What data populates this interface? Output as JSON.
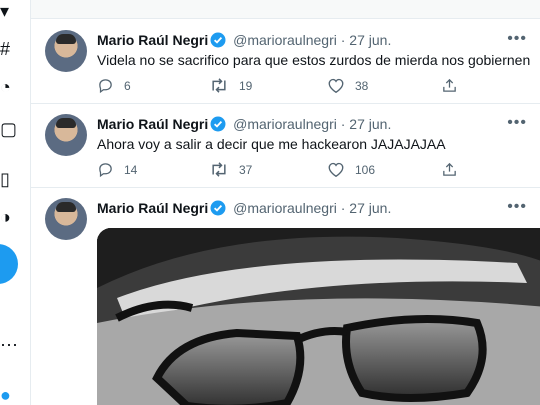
{
  "colors": {
    "accent": "#1d9bf0",
    "secondary_text": "#536471",
    "primary_text": "#0f1419",
    "divider": "#e6ecf0"
  },
  "tweets": [
    {
      "author": {
        "name": "Mario Raúl Negri",
        "handle": "@marioraulnegri",
        "separator": "·",
        "date": "27 jun."
      },
      "text": "Videla no se sacrifico para que estos zurdos de mierda nos gobiernen",
      "reply_count": "6",
      "retweet_count": "19",
      "like_count": "38",
      "more_icon": "more-horizontal-icon"
    },
    {
      "author": {
        "name": "Mario Raúl Negri",
        "handle": "@marioraulnegri",
        "separator": "·",
        "date": "27 jun."
      },
      "text": "Ahora voy a salir a decir que me hackearon JAJAJAJAA",
      "reply_count": "14",
      "retweet_count": "37",
      "like_count": "106",
      "more_icon": "more-horizontal-icon"
    },
    {
      "author": {
        "name": "Mario Raúl Negri",
        "handle": "@marioraulnegri",
        "separator": "·",
        "date": "27 jun."
      },
      "media": "black-and-white photo of a man in a military cap and sunglasses",
      "more_icon": "more-horizontal-icon"
    }
  ]
}
